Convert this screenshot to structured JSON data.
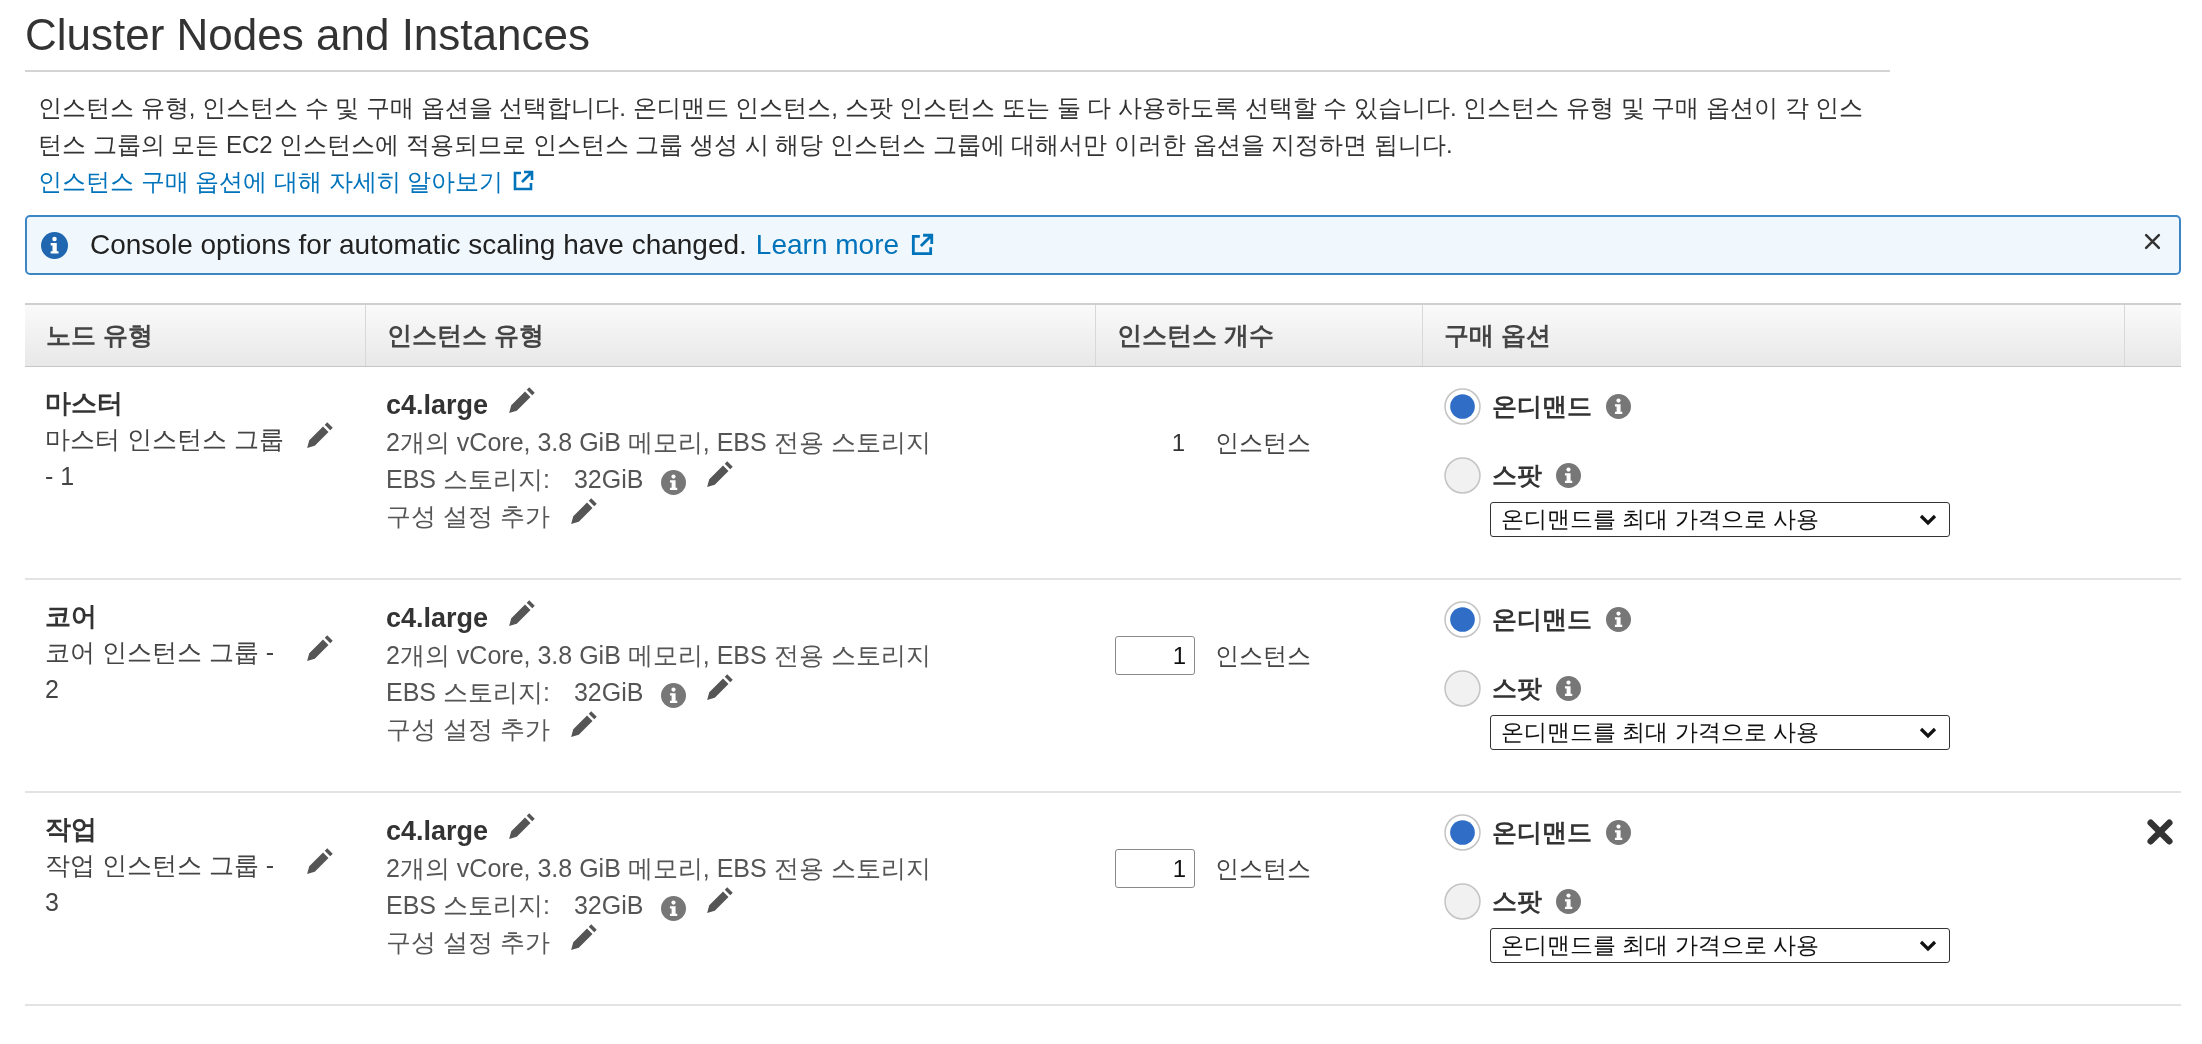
{
  "section": {
    "title": "Cluster Nodes and Instances",
    "description": "인스턴스 유형, 인스턴스 수 및 구매 옵션을 선택합니다. 온디맨드 인스턴스, 스팟 인스턴스 또는 둘 다 사용하도록 선택할 수 있습니다. 인스턴스 유형 및 구매 옵션이 각 인스턴스 그룹의 모든 EC2 인스턴스에 적용되므로 인스턴스 그룹 생성 시 해당 인스턴스 그룹에 대해서만 이러한 옵션을 지정하면 됩니다.",
    "link": "인스턴스 구매 옵션에 대해 자세히 알아보기"
  },
  "alert": {
    "message": "Console options for automatic scaling have changed.",
    "link": "Learn more"
  },
  "table": {
    "columns": [
      "노드 유형",
      "인스턴스 유형",
      "인스턴스 개수",
      "구매 옵션"
    ],
    "rows": [
      {
        "node_type": "마스터",
        "group": "마스터 인스턴스 그룹 - 1",
        "instance_type": "c4.large",
        "specs": "2개의 vCore, 3.8 GiB 메모리, EBS 전용 스토리지",
        "storage_label": "EBS 스토리지:",
        "storage_value": "32GiB",
        "config": "구성 설정 추가",
        "count": {
          "kind": "text",
          "value": "1"
        },
        "count_unit": "인스턴스",
        "purchase_options": [
          {
            "label": "온디맨드",
            "selected": true
          },
          {
            "label": "스팟",
            "selected": false
          }
        ],
        "max_price": "온디맨드를 최대 가격으로 사용",
        "removable": false
      },
      {
        "node_type": "코어",
        "group": "코어 인스턴스 그룹 - 2",
        "instance_type": "c4.large",
        "specs": "2개의 vCore, 3.8 GiB 메모리, EBS 전용 스토리지",
        "storage_label": "EBS 스토리지:",
        "storage_value": "32GiB",
        "config": "구성 설정 추가",
        "count": {
          "kind": "input",
          "value": "1"
        },
        "count_unit": "인스턴스",
        "purchase_options": [
          {
            "label": "온디맨드",
            "selected": true
          },
          {
            "label": "스팟",
            "selected": false
          }
        ],
        "max_price": "온디맨드를 최대 가격으로 사용",
        "removable": false
      },
      {
        "node_type": "작업",
        "group": "작업 인스턴스 그룹 - 3",
        "instance_type": "c4.large",
        "specs": "2개의 vCore, 3.8 GiB 메모리, EBS 전용 스토리지",
        "storage_label": "EBS 스토리지:",
        "storage_value": "32GiB",
        "config": "구성 설정 추가",
        "count": {
          "kind": "input",
          "value": "1"
        },
        "count_unit": "인스턴스",
        "purchase_options": [
          {
            "label": "온디맨드",
            "selected": true
          },
          {
            "label": "스팟",
            "selected": false
          }
        ],
        "max_price": "온디맨드를 최대 가격으로 사용",
        "removable": true
      }
    ]
  }
}
